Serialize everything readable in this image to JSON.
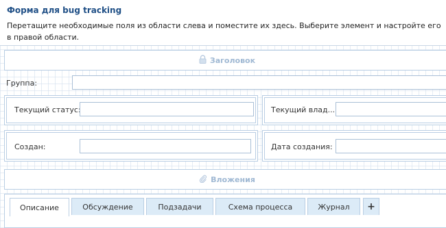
{
  "header": {
    "title": "Форма для bug tracking",
    "description": "Перетащите необходимые поля из области слева и поместите их здесь. Выберите элемент и настройте его в правой области."
  },
  "form": {
    "header_band": {
      "label": "Заголовок",
      "icon": "lock-icon"
    },
    "group_label": "Группа:",
    "status_label": "Текущий статус:",
    "owner_label": "Текущий влад...",
    "created_by_label": "Создан:",
    "created_date_label": "Дата создания:",
    "attachments_band": {
      "label": "Вложения",
      "icon": "paperclip-icon"
    }
  },
  "tabs": [
    {
      "label": "Описание",
      "active": true
    },
    {
      "label": "Обсуждение",
      "active": false
    },
    {
      "label": "Подзадачи",
      "active": false
    },
    {
      "label": "Схема процесса",
      "active": false
    },
    {
      "label": "Журнал",
      "active": false
    }
  ],
  "add_tab_label": "+",
  "colors": {
    "title": "#1f4f86",
    "band_text": "#9fb8d3",
    "border": "#b8cde3",
    "tab_bg": "#dcebf7"
  }
}
